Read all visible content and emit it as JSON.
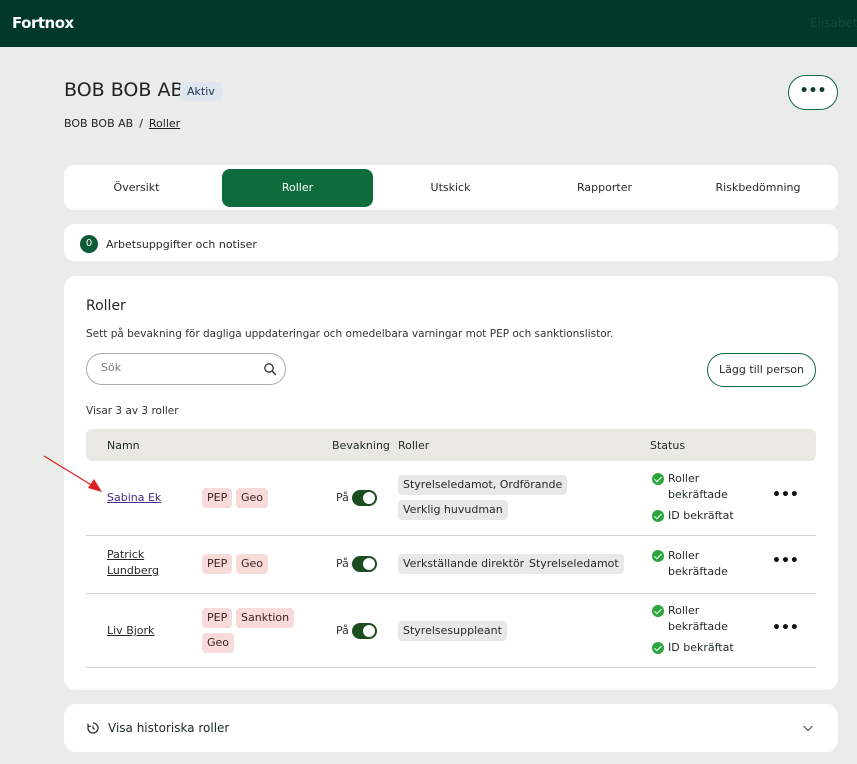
{
  "app": {
    "logo": "Fortnox",
    "user_fragment": "Elisabet"
  },
  "header": {
    "company": "BOB BOB AB",
    "status_badge": "Aktiv",
    "breadcrumb": {
      "root": "BOB BOB AB",
      "sep": "/",
      "current": "Roller"
    },
    "more_label": "•••"
  },
  "tabs": [
    "Översikt",
    "Roller",
    "Utskick",
    "Rapporter",
    "Riskbedömning"
  ],
  "active_tab": "Roller",
  "tasks": {
    "count": "0",
    "label": "Arbetsuppgifter och notiser"
  },
  "roles_card": {
    "title": "Roller",
    "description": "Sett på bevakning för dagliga uppdateringar och omedelbara varningar mot PEP och sanktionslistor.",
    "search_placeholder": "Sök",
    "add_button": "Lägg till person",
    "showing": "Visar 3 av 3 roller",
    "columns": {
      "name": "Namn",
      "monitoring": "Bevakning",
      "roles": "Roller",
      "status": "Status"
    },
    "rows": [
      {
        "name": "Sabina Ek",
        "tags": [
          "PEP",
          "Geo"
        ],
        "monitoring": "På",
        "roles": [
          "Styrelseledamot, Ordförande",
          "Verklig huvudman"
        ],
        "status_roles": "Roller bekräftade",
        "status_roles_1": "Roller",
        "status_roles_2": "bekräftade",
        "status_id": "ID bekräftat",
        "more": "•••"
      },
      {
        "name_1": "Patrick",
        "name_2": "Lundberg",
        "tags": [
          "PEP",
          "Geo"
        ],
        "monitoring": "På",
        "roles": [
          "Verkställande direktör",
          "Styrelseledamot"
        ],
        "status_roles_1": "Roller",
        "status_roles_2": "bekräftade",
        "more": "•••"
      },
      {
        "name": "Liv Bjork",
        "tags": [
          "PEP",
          "Sanktion",
          "Geo"
        ],
        "monitoring": "På",
        "roles": [
          "Styrelsesuppleant"
        ],
        "status_roles_1": "Roller",
        "status_roles_2": "bekräftade",
        "status_id": "ID bekräftat",
        "more": "•••"
      }
    ]
  },
  "history": {
    "label": "Visa historiska roller"
  },
  "colors": {
    "brand_dark": "#00392b",
    "accent_green": "#0d6b3c",
    "tag_red": "#f7dada",
    "check_green": "#2aa63a",
    "annotation_arrow": "#e02020"
  }
}
